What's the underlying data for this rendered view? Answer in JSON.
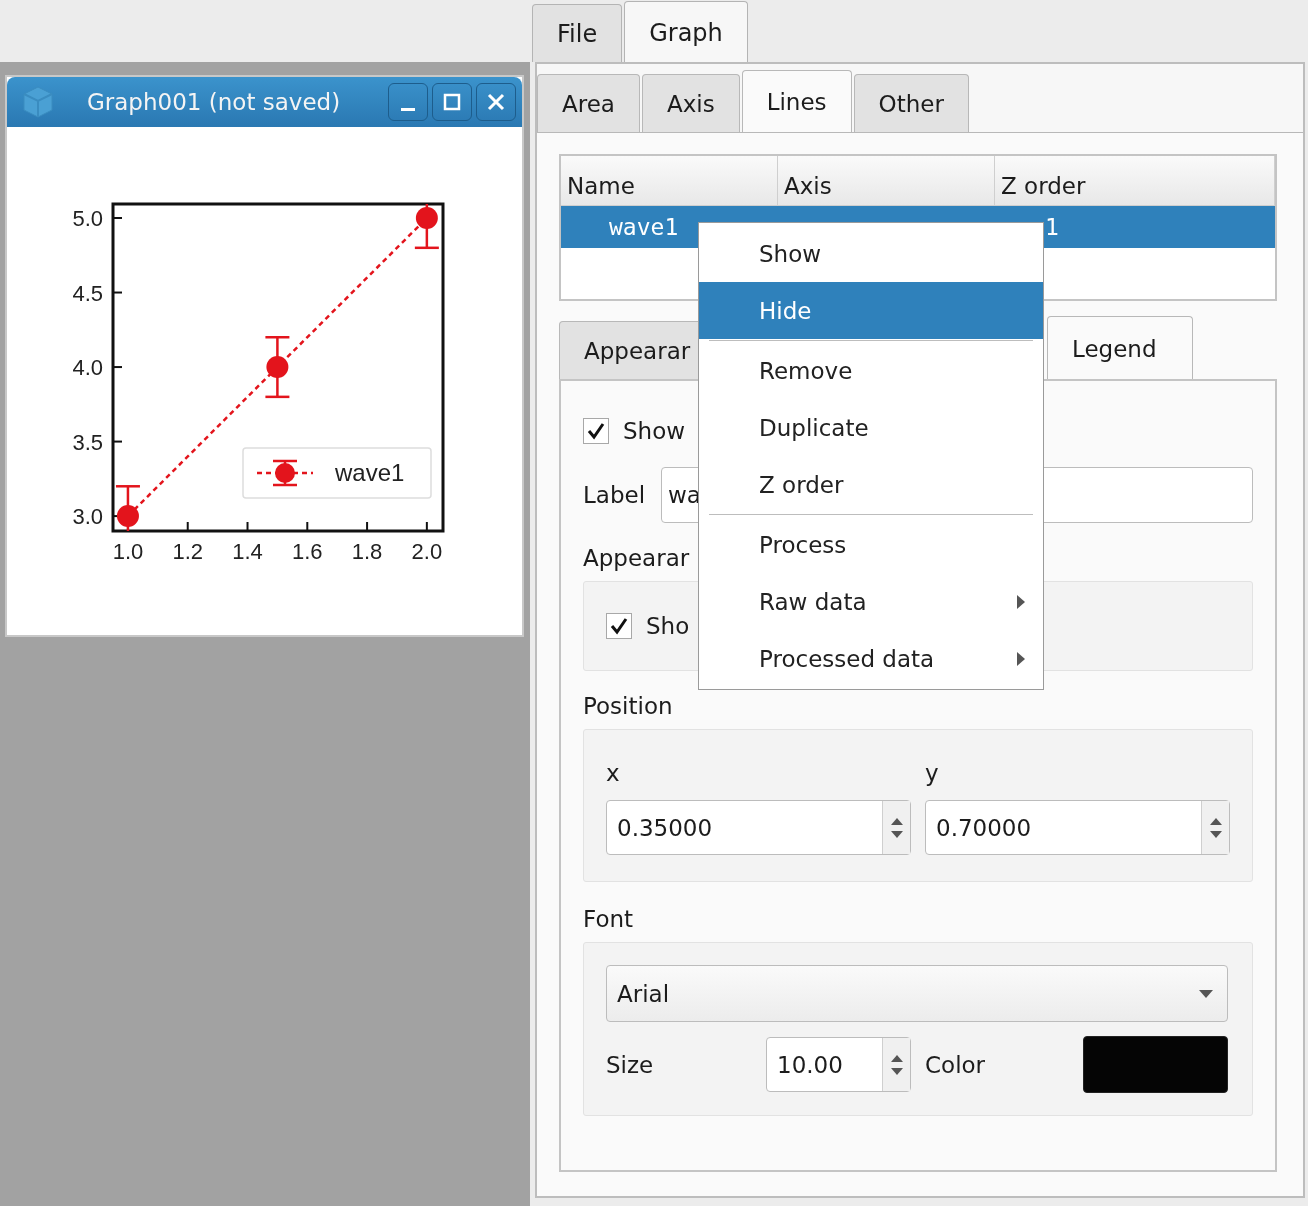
{
  "top_tabs": [
    {
      "label": "File",
      "selected": false
    },
    {
      "label": "Graph",
      "selected": true
    }
  ],
  "graph_window": {
    "title": "Graph001 (not saved)",
    "chart_data": {
      "type": "line",
      "x": [
        1.0,
        1.5,
        2.0
      ],
      "series": [
        {
          "name": "wave1",
          "color": "#e3141c",
          "values": [
            3.0,
            4.0,
            5.0
          ],
          "errors": [
            0.2,
            0.2,
            0.2
          ],
          "line_style": "dashed",
          "marker": "circle"
        }
      ],
      "xlim": [
        0.95,
        2.054
      ],
      "ylim": [
        2.9,
        5.094
      ],
      "xticks": [
        {
          "value": 1.0,
          "label": "1.0"
        },
        {
          "value": 1.2,
          "label": "1.2"
        },
        {
          "value": 1.4,
          "label": "1.4"
        },
        {
          "value": 1.6,
          "label": "1.6"
        },
        {
          "value": 1.8,
          "label": "1.8"
        },
        {
          "value": 2.0,
          "label": "2.0"
        }
      ],
      "yticks": [
        {
          "value": 3.0,
          "label": "3.0"
        },
        {
          "value": 3.5,
          "label": "3.5"
        },
        {
          "value": 4.0,
          "label": "4.0"
        },
        {
          "value": 4.5,
          "label": "4.5"
        },
        {
          "value": 5.0,
          "label": "5.0"
        }
      ]
    }
  },
  "sub_tabs": [
    {
      "label": "Area",
      "selected": false
    },
    {
      "label": "Axis",
      "selected": false
    },
    {
      "label": "Lines",
      "selected": true
    },
    {
      "label": "Other",
      "selected": false
    }
  ],
  "lines_table": {
    "columns": [
      "Name",
      "Axis",
      "Z order"
    ],
    "rows": [
      {
        "name": "wave1",
        "z_order": "1",
        "selected": true
      }
    ]
  },
  "detail_tabs": [
    {
      "label": "Appearar",
      "selected": false
    },
    {
      "label": "Legend",
      "selected": true
    }
  ],
  "legend_tab": {
    "show": {
      "label": "Show",
      "checked": true
    },
    "label_field": {
      "label": "Label",
      "value": "wa"
    },
    "appearance_heading": "Appearar",
    "appearance_show": {
      "label": "Sho",
      "checked": true
    },
    "position_heading": "Position",
    "x": {
      "label": "x",
      "value": "0.35000"
    },
    "y": {
      "label": "y",
      "value": "0.70000"
    },
    "font_heading": "Font",
    "font": "Arial",
    "size_label": "Size",
    "size": "10.00",
    "color_label": "Color",
    "color": "#050505"
  },
  "context_menu": [
    {
      "kind": "item",
      "label": "Show",
      "selected": false
    },
    {
      "kind": "item",
      "label": "Hide",
      "selected": true
    },
    {
      "kind": "separator"
    },
    {
      "kind": "item",
      "label": "Remove",
      "selected": false
    },
    {
      "kind": "item",
      "label": "Duplicate",
      "selected": false
    },
    {
      "kind": "item",
      "label": "Z order",
      "selected": false
    },
    {
      "kind": "separator"
    },
    {
      "kind": "item",
      "label": "Process",
      "selected": false
    },
    {
      "kind": "submenu",
      "label": "Raw data",
      "selected": false
    },
    {
      "kind": "submenu",
      "label": "Processed data",
      "selected": false
    }
  ]
}
